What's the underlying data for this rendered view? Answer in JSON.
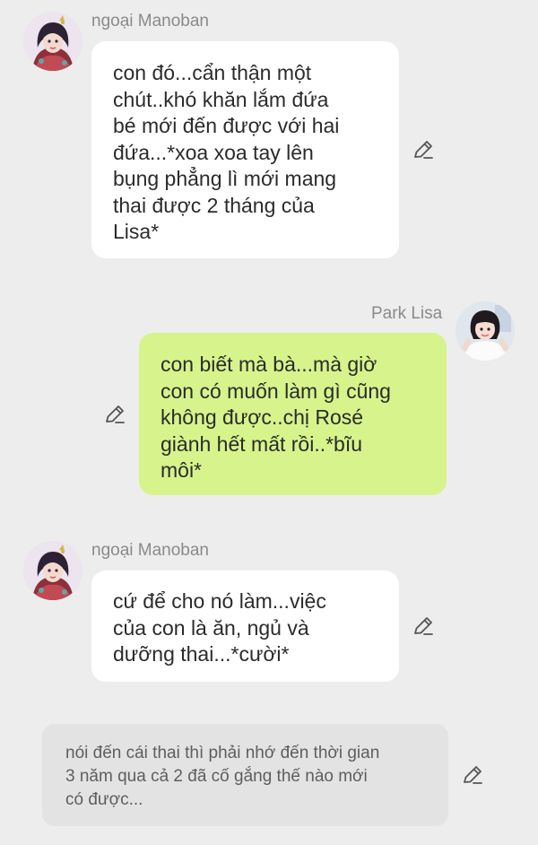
{
  "messages": [
    {
      "sender": "ngoại Manoban",
      "side": "left",
      "text": "con đó...cẩn thận một\nchút..khó khăn lắm đứa\nbé mới đến được với hai\nđứa...*xoa xoa tay lên\nbụng phẳng lì mới mang\nthai được 2 tháng của\nLisa*"
    },
    {
      "sender": "Park Lisa",
      "side": "right",
      "text": "con biết mà bà...mà giờ\ncon có muốn làm gì cũng\nkhông được..chị Rosé\ngiành hết mất rồi..*bĩu\nmôi*"
    },
    {
      "sender": "ngoại Manoban",
      "side": "left",
      "text": "cứ để cho nó làm...việc\ncủa con là ăn, ngủ và\ndưỡng thai...*cười*"
    },
    {
      "type": "narration",
      "text": "nói đến cái thai thì phải nhớ đến thời gian\n3 năm qua cả 2 đã cố gắng thế nào mới\ncó được..."
    }
  ],
  "colors": {
    "background": "#ededed",
    "incoming_bubble": "#ffffff",
    "outgoing_bubble": "#d6f48b",
    "narration_bubble": "#e3e3e3",
    "name_text": "#8a8a8a"
  },
  "icons": {
    "edit": "pencil-icon"
  }
}
